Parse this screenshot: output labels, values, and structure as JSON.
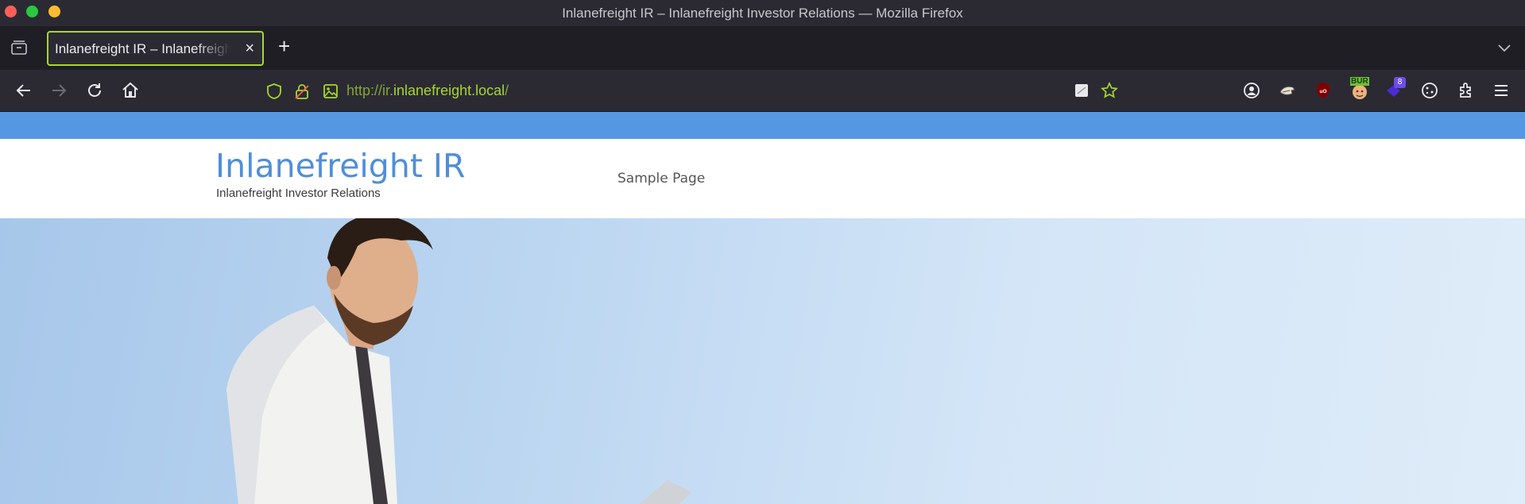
{
  "window": {
    "title": "Inlanefreight IR – Inlanefreight Investor Relations — Mozilla Firefox"
  },
  "tabs": [
    {
      "title": "Inlanefreight IR – Inlanefreight Investor Relations",
      "active": true
    }
  ],
  "toolbar": {
    "url_prefix": "http://ir.",
    "url_domain": "inlanefreight.local",
    "url_suffix": "/",
    "extensions": [
      {
        "name": "account-icon"
      },
      {
        "name": "tamper-icon"
      },
      {
        "name": "ublock-icon"
      },
      {
        "name": "burp-icon",
        "badge": "BUR"
      },
      {
        "name": "wappalyzer-icon",
        "badge": "8"
      },
      {
        "name": "cookie-icon"
      },
      {
        "name": "extensions-icon"
      },
      {
        "name": "menu-icon"
      }
    ]
  },
  "page": {
    "site_title": "Inlanefreight IR",
    "tagline": "Inlanefreight Investor Relations",
    "menu": [
      "Sample Page"
    ],
    "hero_image": "businessman-with-laptop-photo"
  },
  "colors": {
    "accent_bar": "#5697e2",
    "url_green": "#a6d82d",
    "title_blue": "#4f8fd9"
  }
}
